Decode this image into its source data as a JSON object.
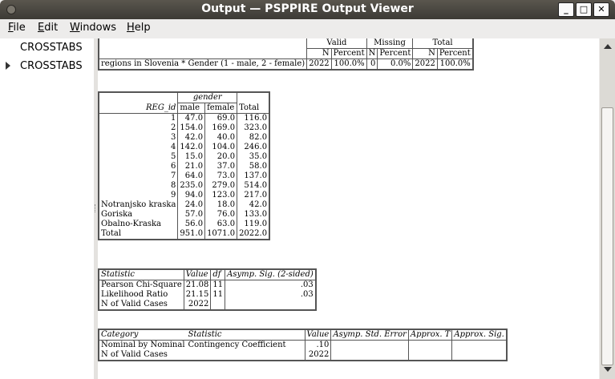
{
  "window": {
    "title": "Output — PSPPIRE Output Viewer",
    "minimize": "_",
    "maximize": "□",
    "close": "✕"
  },
  "menu": {
    "file": "File",
    "edit": "Edit",
    "windows": "Windows",
    "help": "Help"
  },
  "sidebar": {
    "items": [
      {
        "label": "CROSSTABS"
      },
      {
        "label": "CROSSTABS"
      }
    ]
  },
  "summary_table": {
    "headers": {
      "valid": "Valid",
      "missing": "Missing",
      "total": "Total",
      "n": "N",
      "percent": "Percent"
    },
    "row": {
      "label": "regions in Slovenia * Gender (1 - male, 2 - female)",
      "valid_n": "2022",
      "valid_pct": "100.0%",
      "missing_n": "0",
      "missing_pct": "0.0%",
      "total_n": "2022",
      "total_pct": "100.0%"
    }
  },
  "crosstab": {
    "group_header": "gender",
    "row_header": "REG_id",
    "col_headers": [
      "male",
      "female",
      "Total"
    ],
    "rows": [
      {
        "label": "1",
        "male": "47.0",
        "female": "69.0",
        "total": "116.0"
      },
      {
        "label": "2",
        "male": "154.0",
        "female": "169.0",
        "total": "323.0"
      },
      {
        "label": "3",
        "male": "42.0",
        "female": "40.0",
        "total": "82.0"
      },
      {
        "label": "4",
        "male": "142.0",
        "female": "104.0",
        "total": "246.0"
      },
      {
        "label": "5",
        "male": "15.0",
        "female": "20.0",
        "total": "35.0"
      },
      {
        "label": "6",
        "male": "21.0",
        "female": "37.0",
        "total": "58.0"
      },
      {
        "label": "7",
        "male": "64.0",
        "female": "73.0",
        "total": "137.0"
      },
      {
        "label": "8",
        "male": "235.0",
        "female": "279.0",
        "total": "514.0"
      },
      {
        "label": "9",
        "male": "94.0",
        "female": "123.0",
        "total": "217.0"
      },
      {
        "label": "Notranjsko kraska",
        "male": "24.0",
        "female": "18.0",
        "total": "42.0"
      },
      {
        "label": "Goriska",
        "male": "57.0",
        "female": "76.0",
        "total": "133.0"
      },
      {
        "label": "Obalno-Kraska",
        "male": "56.0",
        "female": "63.0",
        "total": "119.0"
      },
      {
        "label": "Total",
        "male": "951.0",
        "female": "1071.0",
        "total": "2022.0"
      }
    ]
  },
  "chisq": {
    "headers": {
      "statistic": "Statistic",
      "value": "Value",
      "df": "df",
      "sig": "Asymp. Sig. (2-sided)"
    },
    "rows": [
      {
        "label": "Pearson Chi-Square",
        "value": "21.08",
        "df": "11",
        "sig": ".03"
      },
      {
        "label": "Likelihood Ratio",
        "value": "21.15",
        "df": "11",
        "sig": ".03"
      },
      {
        "label": "N of Valid Cases",
        "value": "2022",
        "df": "",
        "sig": ""
      }
    ]
  },
  "symm": {
    "headers": {
      "category": "Category",
      "statistic": "Statistic",
      "value": "Value",
      "se": "Asymp. Std. Error",
      "t": "Approx. T",
      "sig": "Approx. Sig."
    },
    "rows": [
      {
        "category": "Nominal by Nominal",
        "statistic": "Contingency Coefficient",
        "value": ".10"
      },
      {
        "category": "N of Valid Cases",
        "statistic": "",
        "value": "2022"
      }
    ]
  }
}
